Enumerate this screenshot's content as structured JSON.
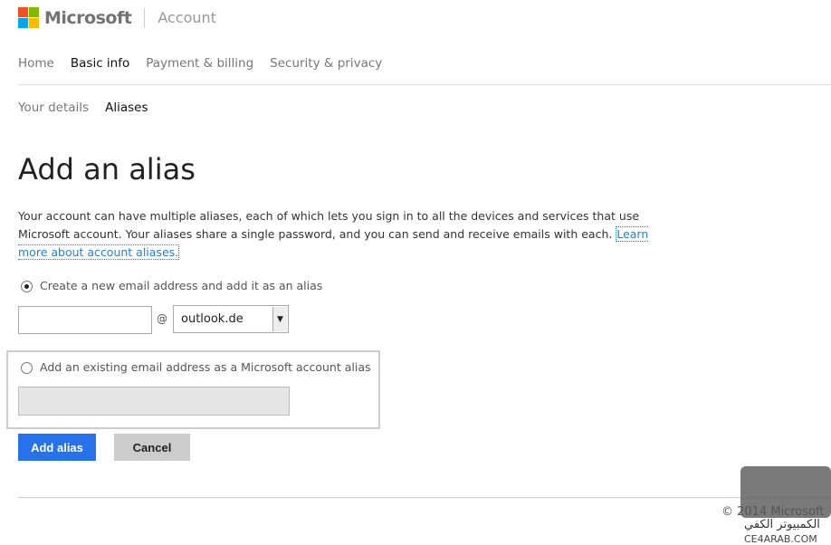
{
  "header": {
    "brand": "Microsoft",
    "section": "Account",
    "logo_colors": [
      "#f25022",
      "#7fba00",
      "#00a4ef",
      "#ffb900"
    ]
  },
  "nav": {
    "items": [
      {
        "label": "Home"
      },
      {
        "label": "Basic info",
        "selected": true
      },
      {
        "label": "Payment & billing"
      },
      {
        "label": "Security & privacy"
      }
    ]
  },
  "subnav": {
    "items": [
      {
        "label": "Your details"
      },
      {
        "label": "Aliases",
        "selected": true
      }
    ]
  },
  "page": {
    "title": "Add an alias",
    "description": "Your account can have multiple aliases, each of which lets you sign in to all the devices and services that use Microsoft account. Your aliases share a single password, and you can send and receive emails with each. ",
    "learn_more": "Learn more about account aliases."
  },
  "form": {
    "option_new": {
      "label": "Create a new email address and add it as an alias",
      "selected": true
    },
    "new_value": "",
    "at": "@",
    "domain": "outlook.de",
    "option_existing": {
      "label": "Add an existing email address as a Microsoft account alias",
      "selected": false
    },
    "existing_value": ""
  },
  "buttons": {
    "add": "Add alias",
    "cancel": "Cancel",
    "add_color": "#2672ec"
  },
  "footer": {
    "copyright": "© 2014 Microsoft"
  },
  "watermark": {
    "arabic": "الكمبيوتر الكفي",
    "site": "CE4ARAB.COM"
  }
}
